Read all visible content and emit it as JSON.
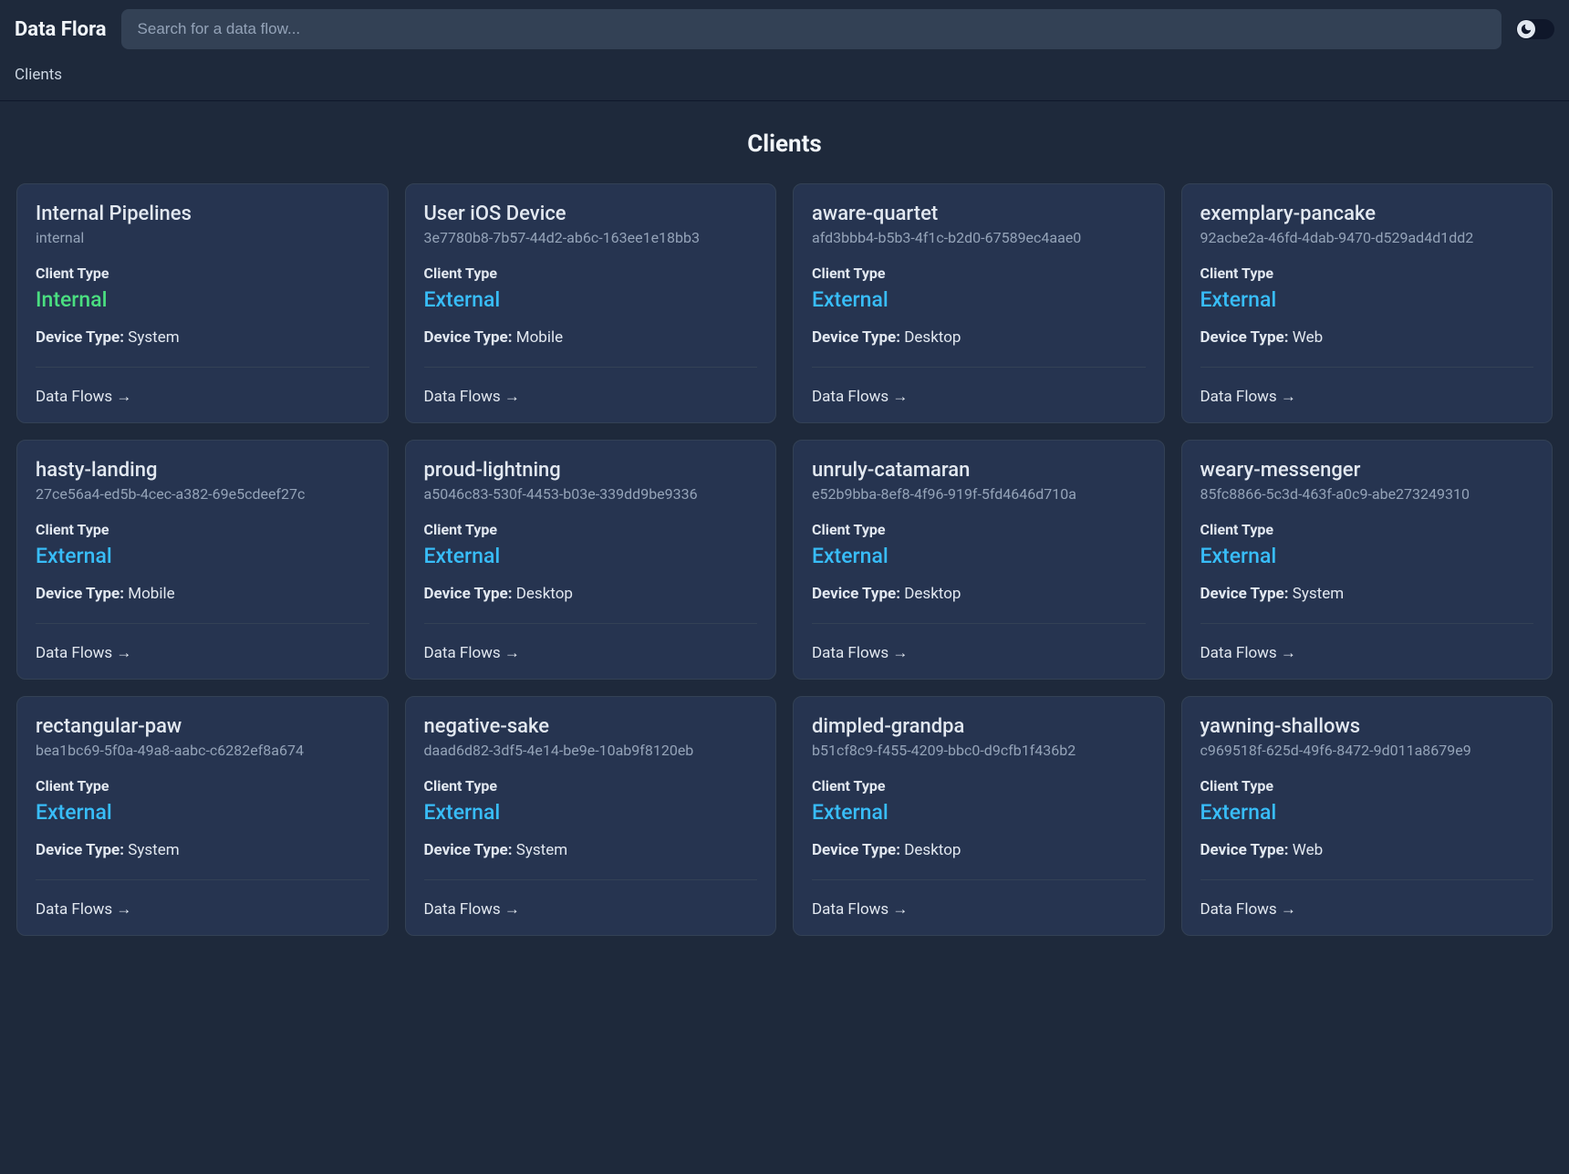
{
  "header": {
    "app_title": "Data Flora",
    "search_placeholder": "Search for a data flow..."
  },
  "breadcrumb": "Clients",
  "page_title": "Clients",
  "labels": {
    "client_type": "Client Type",
    "device_type": "Device Type:",
    "data_flows": "Data Flows →"
  },
  "client_type_values": {
    "internal": "Internal",
    "external": "External"
  },
  "clients": [
    {
      "name": "Internal Pipelines",
      "id": "internal",
      "type": "internal",
      "device": "System"
    },
    {
      "name": "User iOS Device",
      "id": "3e7780b8-7b57-44d2-ab6c-163ee1e18bb3",
      "type": "external",
      "device": "Mobile"
    },
    {
      "name": "aware-quartet",
      "id": "afd3bbb4-b5b3-4f1c-b2d0-67589ec4aae0",
      "type": "external",
      "device": "Desktop"
    },
    {
      "name": "exemplary-pancake",
      "id": "92acbe2a-46fd-4dab-9470-d529ad4d1dd2",
      "type": "external",
      "device": "Web"
    },
    {
      "name": "hasty-landing",
      "id": "27ce56a4-ed5b-4cec-a382-69e5cdeef27c",
      "type": "external",
      "device": "Mobile"
    },
    {
      "name": "proud-lightning",
      "id": "a5046c83-530f-4453-b03e-339dd9be9336",
      "type": "external",
      "device": "Desktop"
    },
    {
      "name": "unruly-catamaran",
      "id": "e52b9bba-8ef8-4f96-919f-5fd4646d710a",
      "type": "external",
      "device": "Desktop"
    },
    {
      "name": "weary-messenger",
      "id": "85fc8866-5c3d-463f-a0c9-abe273249310",
      "type": "external",
      "device": "System"
    },
    {
      "name": "rectangular-paw",
      "id": "bea1bc69-5f0a-49a8-aabc-c6282ef8a674",
      "type": "external",
      "device": "System"
    },
    {
      "name": "negative-sake",
      "id": "daad6d82-3df5-4e14-be9e-10ab9f8120eb",
      "type": "external",
      "device": "System"
    },
    {
      "name": "dimpled-grandpa",
      "id": "b51cf8c9-f455-4209-bbc0-d9cfb1f436b2",
      "type": "external",
      "device": "Desktop"
    },
    {
      "name": "yawning-shallows",
      "id": "c969518f-625d-49f6-8472-9d011a8679e9",
      "type": "external",
      "device": "Web"
    }
  ]
}
